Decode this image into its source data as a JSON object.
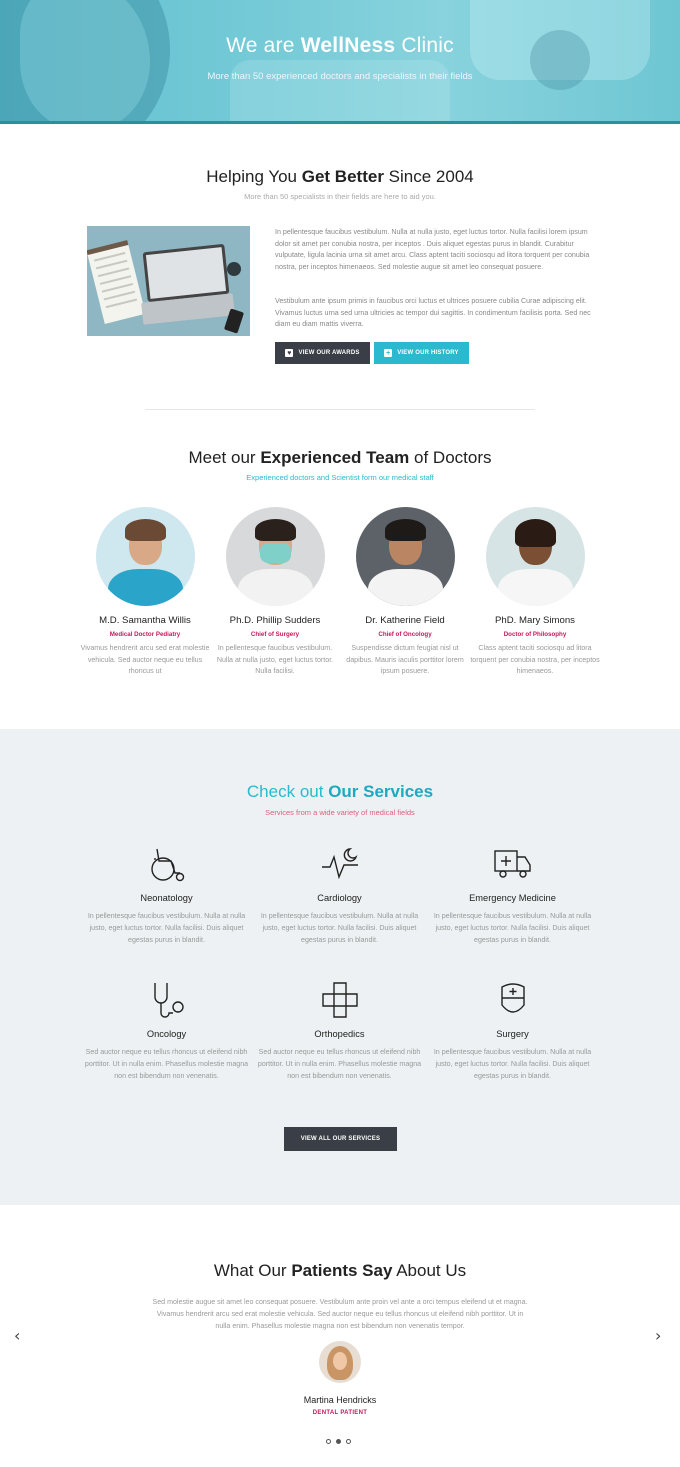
{
  "hero": {
    "title_prefix": "We are",
    "title_bold": "WellNess",
    "title_suffix": "Clinic",
    "subtitle": "More than 50 experienced doctors and specialists in their fields"
  },
  "about": {
    "title_prefix": "Helping You",
    "title_bold": "Get Better",
    "title_suffix": "Since 2004",
    "subtitle": "More than 50 specialists in their fields are here to aid you.",
    "paragraph1": "In pellentesque faucibus vestibulum. Nulla at nulla justo, eget luctus tortor. Nulla facilisi lorem ipsum dolor sit amet per conubia nostra, per inceptos . Duis aliquet egestas purus in blandit. Curabitur vulputate, ligula lacinia urna sit amet arcu. Class aptent taciti sociosqu ad litora torquent per conubia nostra, per inceptos himenaeos. Sed molestie augue sit amet leo consequat posuere.",
    "paragraph2": "Vestibulum ante ipsum primis in faucibus orci luctus et ultrices posuere cubilia Curae adipiscing elit. Vivamus luctus urna sed urna ultricies ac tempor dui sagittis. In condimentum facilisis porta. Sed nec diam eu diam mattis viverra.",
    "btn_awards": "View our awards",
    "btn_history": "View our history"
  },
  "team": {
    "title_prefix": "Meet our",
    "title_bold": "Experienced Team",
    "title_suffix": "of Doctors",
    "subtitle": "Experienced doctors and Scientist form our medical staff",
    "doctors": [
      {
        "name": "M.D. Samantha Willis",
        "role": "Medical Doctor Pediatry",
        "desc": "Vivamus hendrerit arcu sed erat molestie vehicula. Sed auctor neque eu tellus rhoncus ut"
      },
      {
        "name": "Ph.D. Phillip Sudders",
        "role": "Chief of Surgery",
        "desc": "In pellentesque faucibus vestibulum. Nulla at nulla justo, eget luctus tortor. Nulla facilisi."
      },
      {
        "name": "Dr. Katherine Field",
        "role": "Chief of Oncology",
        "desc": "Suspendisse dictum feugiat nisl ut dapibus. Mauris iaculis porttitor lorem ipsum posuere."
      },
      {
        "name": "PhD. Mary Simons",
        "role": "Doctor of Philosophy",
        "desc": "Class aptent taciti sociosqu ad litora torquent per conubia nostra, per inceptos himenaeos."
      }
    ]
  },
  "services": {
    "title_prefix": "Check out",
    "title_bold": "Our Services",
    "subtitle": "Services from a wide variety of medical fields",
    "items": [
      {
        "name": "Neonatology",
        "icon": "wheelchair-icon",
        "desc": "In pellentesque faucibus vestibulum. Nulla at nulla justo, eget luctus tortor. Nulla facilisi. Duis aliquet egestas purus in blandit."
      },
      {
        "name": "Cardiology",
        "icon": "heartbeat-moon-icon",
        "desc": "In pellentesque faucibus vestibulum. Nulla at nulla justo, eget luctus tortor. Nulla facilisi. Duis aliquet egestas purus in blandit."
      },
      {
        "name": "Emergency Medicine",
        "icon": "ambulance-icon",
        "desc": "In pellentesque faucibus vestibulum. Nulla at nulla justo, eget luctus tortor. Nulla facilisi. Duis aliquet egestas purus in blandit."
      },
      {
        "name": "Oncology",
        "icon": "stethoscope-icon",
        "desc": "Sed auctor neque eu tellus rhoncus ut eleifend nibh porttitor. Ut in nulla enim. Phasellus molestie magna non est bibendum non venenatis."
      },
      {
        "name": "Orthopedics",
        "icon": "medical-cross-icon",
        "desc": "Sed auctor neque eu tellus rhoncus ut eleifend nibh porttitor. Ut in nulla enim. Phasellus molestie magna non est bibendum non venenatis."
      },
      {
        "name": "Surgery",
        "icon": "shield-plus-icon",
        "desc": "In pellentesque faucibus vestibulum. Nulla at nulla justo, eget luctus tortor. Nulla facilisi. Duis aliquet egestas purus in blandit."
      }
    ],
    "btn_all": "View all our services"
  },
  "testimonials": {
    "title_prefix": "What Our",
    "title_bold": "Patients Say",
    "title_suffix": "About Us",
    "quote": "Sed molestie augue sit amet leo consequat posuere. Vestibulum ante proin vel ante a orci tempus eleifend ut et magna. Vivamus hendrerit arcu sed erat molestie vehicula. Sed auctor neque eu tellus rhoncus ut eleifend nibh porttitor. Ut in nulla enim. Phasellus molestie magna non est bibendum non venenatis tempor.",
    "name": "Martina Hendricks",
    "role": "DENTAL PATIENT",
    "active_slide": 2,
    "slide_count": 3
  },
  "colors": {
    "accent": "#2ab9cf",
    "pink": "#c2185b",
    "dark_button": "#3a3f47",
    "services_bg": "#edf1f3"
  }
}
